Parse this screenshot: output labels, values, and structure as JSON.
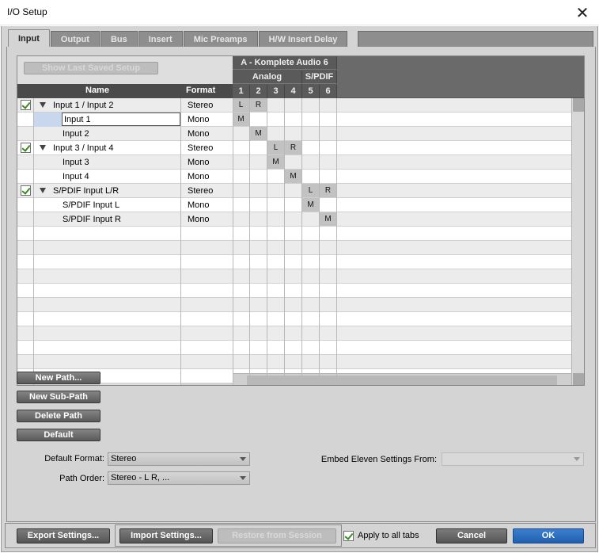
{
  "window": {
    "title": "I/O Setup",
    "close_glyph": "✕"
  },
  "tabs": [
    {
      "label": "Input",
      "active": true
    },
    {
      "label": "Output"
    },
    {
      "label": "Bus"
    },
    {
      "label": "Insert"
    },
    {
      "label": "Mic Preamps"
    },
    {
      "label": "H/W Insert Delay"
    }
  ],
  "grid": {
    "show_last_saved": "Show Last Saved Setup",
    "col_name": "Name",
    "col_format": "Format",
    "device": "A - Komplete Audio 6",
    "groups": [
      {
        "label": "Analog",
        "span": 4
      },
      {
        "label": "S/PDIF",
        "span": 2
      }
    ],
    "channels": [
      "1",
      "2",
      "3",
      "4",
      "5",
      "6"
    ],
    "paths": [
      {
        "kind": "main",
        "checked": true,
        "name": "Input 1 / Input 2",
        "format": "Stereo",
        "marks": [
          {
            "ch": 0,
            "t": "L"
          },
          {
            "ch": 1,
            "t": "R"
          }
        ]
      },
      {
        "kind": "sub",
        "name": "Input 1",
        "format": "Mono",
        "editing": true,
        "marks": [
          {
            "ch": 0,
            "t": "M"
          }
        ]
      },
      {
        "kind": "sub",
        "name": "Input 2",
        "format": "Mono",
        "marks": [
          {
            "ch": 1,
            "t": "M"
          }
        ]
      },
      {
        "kind": "main",
        "checked": true,
        "name": "Input 3 / Input 4",
        "format": "Stereo",
        "marks": [
          {
            "ch": 2,
            "t": "L"
          },
          {
            "ch": 3,
            "t": "R"
          }
        ]
      },
      {
        "kind": "sub",
        "name": "Input 3",
        "format": "Mono",
        "marks": [
          {
            "ch": 2,
            "t": "M"
          }
        ]
      },
      {
        "kind": "sub",
        "name": "Input 4",
        "format": "Mono",
        "marks": [
          {
            "ch": 3,
            "t": "M"
          }
        ]
      },
      {
        "kind": "main",
        "checked": true,
        "name": "S/PDIF Input L/R",
        "format": "Stereo",
        "marks": [
          {
            "ch": 4,
            "t": "L"
          },
          {
            "ch": 5,
            "t": "R"
          }
        ]
      },
      {
        "kind": "sub",
        "name": "S/PDIF Input L",
        "format": "Mono",
        "marks": [
          {
            "ch": 4,
            "t": "M"
          }
        ]
      },
      {
        "kind": "sub",
        "name": "S/PDIF Input R",
        "format": "Mono",
        "marks": [
          {
            "ch": 5,
            "t": "M"
          }
        ]
      }
    ],
    "empty_rows": 11
  },
  "path_buttons": {
    "new_path": "New Path...",
    "new_sub_path": "New Sub-Path",
    "delete_path": "Delete Path",
    "default": "Default"
  },
  "options": {
    "default_format_label": "Default Format:",
    "default_format_value": "Stereo",
    "path_order_label": "Path Order:",
    "path_order_value": "Stereo - L R, ...",
    "embed_label": "Embed Eleven Settings From:",
    "embed_value": ""
  },
  "footer": {
    "export": "Export Settings...",
    "import": "Import Settings...",
    "restore": "Restore from Session",
    "apply_all": "Apply to all tabs",
    "apply_all_checked": true,
    "cancel": "Cancel",
    "ok": "OK"
  },
  "colors": {
    "ok_button": "#2a6cc0",
    "check_green": "#3a8a1f",
    "header_dark": "#4a4a4a"
  }
}
